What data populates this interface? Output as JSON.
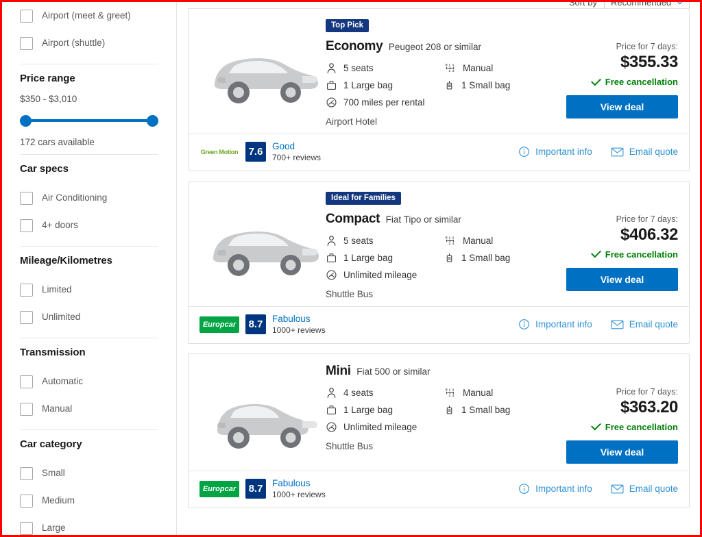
{
  "sidebar": {
    "pickup_filters": [
      {
        "label": "Airport (meet & greet)",
        "checked": false
      },
      {
        "label": "Airport (shuttle)",
        "checked": false
      }
    ],
    "price_range": {
      "title": "Price range",
      "value_text": "$350 - $3,010",
      "availability": "172 cars available"
    },
    "sections": [
      {
        "title": "Car specs",
        "options": [
          {
            "label": "Air Conditioning",
            "checked": false
          },
          {
            "label": "4+ doors",
            "checked": false
          }
        ]
      },
      {
        "title": "Mileage/Kilometres",
        "options": [
          {
            "label": "Limited",
            "checked": false
          },
          {
            "label": "Unlimited",
            "checked": false
          }
        ]
      },
      {
        "title": "Transmission",
        "options": [
          {
            "label": "Automatic",
            "checked": false
          },
          {
            "label": "Manual",
            "checked": false
          }
        ]
      },
      {
        "title": "Car category",
        "options": [
          {
            "label": "Small",
            "checked": false
          },
          {
            "label": "Medium",
            "checked": false
          },
          {
            "label": "Large",
            "checked": false
          }
        ]
      }
    ]
  },
  "sort": {
    "label": "Sort by",
    "selected": "Recommended"
  },
  "labels": {
    "price_prefix": "Price for 7 days:",
    "free_cancellation": "Free cancellation",
    "view_deal": "View deal",
    "important_info": "Important info",
    "email_quote": "Email quote"
  },
  "colors": {
    "accent_blue": "#0071c2",
    "badge_navy": "#14387f",
    "score_navy": "#003580",
    "green": "#008009",
    "europcar_green": "#00a443",
    "link_blue": "#2f92d6"
  },
  "results": [
    {
      "badge": "Top Pick",
      "car_class": "Economy",
      "car_model": "Peugeot 208 or similar",
      "seats": "5 seats",
      "transmission": "Manual",
      "large_bag": "1 Large bag",
      "small_bag": "1 Small bag",
      "mileage": "700 miles per rental",
      "pickup": "Airport Hotel",
      "price_label": "Price for 7 days:",
      "price": "$355.33",
      "free_cancellation": "Free cancellation",
      "cta": "View deal",
      "supplier": "Green Motion",
      "supplier_key": "greenmotion",
      "score": "7.6",
      "rating_word": "Good",
      "reviews": "700+ reviews"
    },
    {
      "badge": "Ideal for Families",
      "car_class": "Compact",
      "car_model": "Fiat Tipo or similar",
      "seats": "5 seats",
      "transmission": "Manual",
      "large_bag": "1 Large bag",
      "small_bag": "1 Small bag",
      "mileage": "Unlimited mileage",
      "pickup": "Shuttle Bus",
      "price_label": "Price for 7 days:",
      "price": "$406.32",
      "free_cancellation": "Free cancellation",
      "cta": "View deal",
      "supplier": "Europcar",
      "supplier_key": "europcar",
      "score": "8.7",
      "rating_word": "Fabulous",
      "reviews": "1000+ reviews"
    },
    {
      "badge": "",
      "car_class": "Mini",
      "car_model": "Fiat 500 or similar",
      "seats": "4 seats",
      "transmission": "Manual",
      "large_bag": "1 Large bag",
      "small_bag": "1 Small bag",
      "mileage": "Unlimited mileage",
      "pickup": "Shuttle Bus",
      "price_label": "Price for 7 days:",
      "price": "$363.20",
      "free_cancellation": "Free cancellation",
      "cta": "View deal",
      "supplier": "Europcar",
      "supplier_key": "europcar",
      "score": "8.7",
      "rating_word": "Fabulous",
      "reviews": "1000+ reviews"
    }
  ]
}
